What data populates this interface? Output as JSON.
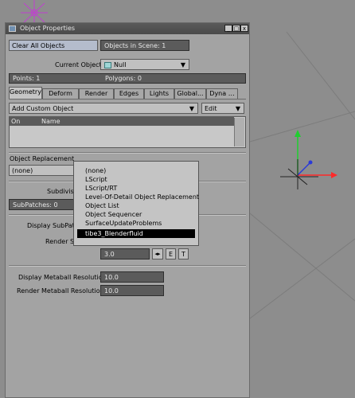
{
  "window": {
    "title": "Object Properties",
    "clear_all": "Clear All Objects",
    "objects_in_scene": "Objects in Scene: 1",
    "current_object_label": "Current Object",
    "current_object_value": "Null",
    "points": "Points: 1",
    "polygons": "Polygons: 0",
    "min_label": "_",
    "max_label": "□",
    "close_label": "x"
  },
  "tabs": [
    "Geometry",
    "Deform",
    "Render",
    "Edges",
    "Lights",
    "Global...",
    "Dyna"
  ],
  "geometry": {
    "add_custom_object": "Add Custom Object",
    "edit": "Edit",
    "col_on": "On",
    "col_name": "Name",
    "object_replacement_label": "Object Replacement",
    "object_replacement_value": "(none)",
    "subdivision_label": "Subdivisi",
    "subpatches": "SubPatches: 0",
    "display_subpatch_label": "Display SubPat",
    "render_subpatch_label": "Render S",
    "render_level_value": "3.0",
    "env_e": "E",
    "env_t": "T",
    "display_metaball_label": "Display Metaball Resolution",
    "display_metaball_value": "10.0",
    "render_metaball_label": "Render Metaball Resolution",
    "render_metaball_value": "10.0"
  },
  "dropdown_menu": {
    "items": [
      "(none)",
      "LScript",
      "LScript/RT",
      "Level-Of-Detail Object Replacement",
      "Object List",
      "Object Sequencer",
      "SurfaceUpdateProblems",
      "tibe3_Blenderfluid"
    ],
    "selected_index": 7
  },
  "colors": {
    "viewport": "#8d8d8d",
    "panel": "#a3a3a3",
    "field": "#5b5b5b",
    "axis_x": "#ff2a2a",
    "axis_y": "#1fcf2f",
    "axis_z": "#2a3ad8",
    "object_green": "#5cff5c",
    "light_magenta": "#c040d0"
  }
}
